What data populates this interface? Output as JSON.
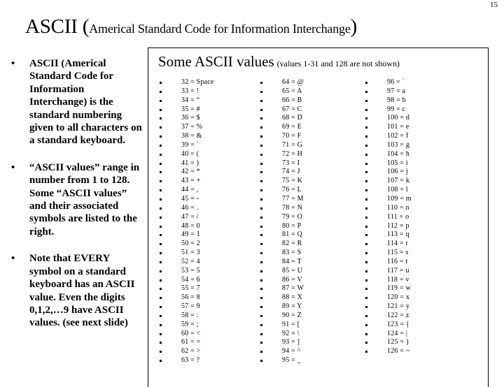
{
  "page": {
    "number": "15"
  },
  "title": {
    "main": "ASCII ",
    "open_paren": "(",
    "sub": "Americal Standard Code for Information Interchange",
    "close_paren": ")"
  },
  "left_column": {
    "bullet_marker": "•",
    "bullets": [
      "ASCII (Americal Standard Code for Information Interchange) is the standard numbering given to all characters on a standard keyboard.",
      "“ASCII values” range in number from 1 to 128. Some “ASCII values” and their associated symbols are listed to the right.",
      "Note that EVERY symbol on a standard keyboard has an ASCII value. Even the digits 0,1,2,…9 have ASCII values. (see next slide)"
    ]
  },
  "ascii_box": {
    "heading_main": "Some ASCII values",
    "heading_note": "(values 1-31 and 128 are not shown)",
    "columns": [
      {
        "name": "column-1",
        "rows": [
          "32 = Space",
          "33 = !",
          "34 = “",
          "35 = #",
          "36 = $",
          "37 = %",
          "38 = &",
          "39 = `",
          "40 = (",
          "41 = )",
          "42 = *",
          "43 = +",
          "44 = ,",
          "45 = -",
          "46 = .",
          "47 = /",
          "48 = 0",
          "49 = 1",
          "50 = 2",
          "51 = 3",
          "52 = 4",
          "53 = 5",
          "54 = 6",
          "55 =  7",
          "56 = 8",
          "57 = 9",
          "58 = :",
          "59 = ;",
          "60 = <",
          "61 = =",
          "62 = >",
          "63 = ?"
        ]
      },
      {
        "name": "column-2",
        "rows": [
          "64 = @",
          "65 = A",
          "66 = B",
          "67 = C",
          "68 = D",
          "69 = E",
          "70 = F",
          "71 = G",
          "72 = H",
          "73 = I",
          "74 = J",
          "75 = K",
          "76 = L",
          "77 = M",
          "78 = N",
          "79 = O",
          "80 = P",
          "81 = Q",
          "82 = R",
          "83 = S",
          "84 = T",
          "85 = U",
          "86 = V",
          "87 = W",
          "88 = X",
          "89 = Y",
          "90 = Z",
          "91 = [",
          "92 = \\",
          "93 = ]",
          "94 = ^",
          "95 = _"
        ]
      },
      {
        "name": "column-3",
        "rows": [
          "96 = `",
          "97 = a",
          "98 = b",
          "99 = c",
          "100 = d",
          "101 = e",
          "102 = f",
          "103 = g",
          "104 = h",
          "105 = i",
          "106 = j",
          "107 = k",
          "108 = l",
          "109 = m",
          "110 = n",
          "111 = o",
          "112 = p",
          "113 = q",
          "114 = r",
          "115 = s",
          "116 = t",
          "117 = u",
          "118 = v",
          "119 = w",
          "120 = x",
          "121 = y",
          "122 = z",
          "123 = {",
          "124 = |",
          "125 = }",
          "126 = ~"
        ]
      }
    ]
  }
}
